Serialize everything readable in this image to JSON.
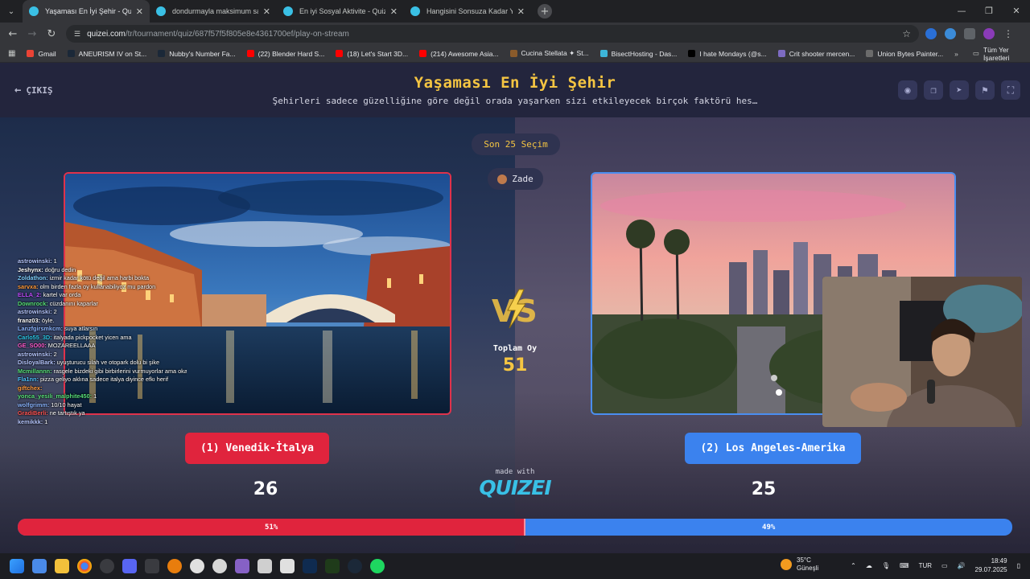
{
  "browser": {
    "tabs": [
      {
        "title": "Yaşaması En İyi Şehir - Quizei",
        "favicon_color": "#3ac0e5",
        "active": true
      },
      {
        "title": "dondurmayla maksimum saran",
        "favicon_color": "#3ac0e5",
        "active": false
      },
      {
        "title": "En iyi Sosyal Aktivite - Quizei",
        "favicon_color": "#3ac0e5",
        "active": false
      },
      {
        "title": "Hangisini Sonsuza Kadar Yasak",
        "favicon_color": "#3ac0e5",
        "active": false
      }
    ],
    "address": {
      "host": "quizei.com",
      "path": "/tr/tournament/quiz/687f57f5f805e8e4361700ef/play-on-stream"
    },
    "bookmarks": [
      {
        "label": "Gmail",
        "color": "#ea4335"
      },
      {
        "label": "ANEURISM IV on St...",
        "color": "#1b2838"
      },
      {
        "label": "Nubby's Number Fa...",
        "color": "#1b2838"
      },
      {
        "label": "(22) Blender Hard S...",
        "color": "#ff0000"
      },
      {
        "label": "(18) Let's Start 3D...",
        "color": "#ff0000"
      },
      {
        "label": "(214) Awesome Asia...",
        "color": "#ff0000"
      },
      {
        "label": "Cucina Stellata ✦ St...",
        "color": "#8a5b2b"
      },
      {
        "label": "BisectHosting - Das...",
        "color": "#3db5d8"
      },
      {
        "label": "I hate Mondays (@s...",
        "color": "#000000"
      },
      {
        "label": "Crit shooter mercen...",
        "color": "#7d6bc2"
      },
      {
        "label": "Union Bytes Painter...",
        "color": "#6b6b6b"
      }
    ],
    "all_bookmarks": "Tüm Yer İşaretleri"
  },
  "quiz": {
    "exit_label": "ÇIKIŞ",
    "title": "Yaşaması En İyi Şehir",
    "subtitle": "Şehirleri sadece güzelliğine göre değil orada yaşarken sizi etkileyecek birçok faktörü hes…",
    "round_label": "Son 25 Seçim",
    "voter_label": "Zade",
    "total_label": "Toplam Oy",
    "total_votes": "51",
    "made_with": "made with",
    "logo_text": "QUIZEI",
    "left": {
      "label": "(1) Venedik-İtalya",
      "votes": "26",
      "percent_text": "51%",
      "percent": 51,
      "color": "#e0243d"
    },
    "right": {
      "label": "(2) Los Angeles-Amerika",
      "votes": "25",
      "percent_text": "49%",
      "percent": 49,
      "color": "#3b82ee"
    }
  },
  "chat": [
    {
      "user": "astrowinski:",
      "msg": "1",
      "color": "#b7c7ff"
    },
    {
      "user": "Jeshynx:",
      "msg": "doğru dedin",
      "color": "#ffffff"
    },
    {
      "user": "Zoldathon:",
      "msg": "izmir kadar kötü değil ama harbi bokta",
      "color": "#7fd0ff"
    },
    {
      "user": "sarvxa:",
      "msg": "olm birden fazla oy kullanabiliyoz mu pardon",
      "color": "#ff9a3c"
    },
    {
      "user": "ELLA_2:",
      "msg": "kartel var orda",
      "color": "#c04dff"
    },
    {
      "user": "Downrock:",
      "msg": "cüzdanını kaparlar",
      "color": "#58e07a"
    },
    {
      "user": "astrowinski:",
      "msg": "2",
      "color": "#b7c7ff"
    },
    {
      "user": "franz03:",
      "msg": "öyle.",
      "color": "#ffffff"
    },
    {
      "user": "Lanzfgirsmkcm:",
      "msg": "suya atlarsın",
      "color": "#8ab4ff"
    },
    {
      "user": "Carlo55_3D:",
      "msg": "italyada pickpocket yicen ama",
      "color": "#2ec7e8"
    },
    {
      "user": "GE_SO00:",
      "msg": "MOZAREELLAAA",
      "color": "#ff5dd0"
    },
    {
      "user": "astrowinski:",
      "msg": "2",
      "color": "#b7c7ff"
    },
    {
      "user": "DisloyalBark:",
      "msg": "uyuşturucu silah ve otopark dolu bi şike",
      "color": "#b7c7ff"
    },
    {
      "user": "Mcmillannn:",
      "msg": "rasgele bizdeki gibi birbirlerini vurmuyorlar ama okadar silaha rağmen",
      "color": "#58e07a"
    },
    {
      "user": "Fla1nn:",
      "msg": "pizza geliyo aklına sadece italya diyince efkı herif",
      "color": "#4fc3ff"
    },
    {
      "user": "giftchex:",
      "msg": "",
      "color": "#ff9a3c"
    },
    {
      "user": "yonca_yesili_malphite450:",
      "msg": "1",
      "color": "#58e07a"
    },
    {
      "user": "wolfgrimm:",
      "msg": "10/10 hayat",
      "color": "#8ab4ff"
    },
    {
      "user": "GradiBerli:",
      "msg": "ne tartıştık ya",
      "color": "#ff5555"
    },
    {
      "user": "kemikkk:",
      "msg": "1",
      "color": "#b7c7ff"
    }
  ],
  "taskbar": {
    "weather_temp": "35°C",
    "weather_desc": "Güneşli",
    "lang": "TUR",
    "time": "18:49",
    "date": "29.07.2025"
  }
}
